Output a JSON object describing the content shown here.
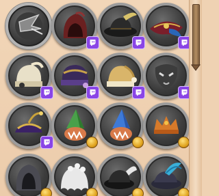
{
  "screen": "cosmetics-hat-grid",
  "colors": {
    "panel_background": "#efd2b3",
    "frame_silver": "#9c9c9c",
    "twitch_badge": "#8a45e6",
    "coin_gold": "#e0a31f",
    "scroll_thumb": "#a07a52"
  },
  "items": [
    {
      "icon": "ninja-mask-hat-icon",
      "badge": "none",
      "selected": true
    },
    {
      "icon": "crimson-hood-hat-icon",
      "badge": "twitch"
    },
    {
      "icon": "feathered-tricorn-hat-icon",
      "badge": "twitch"
    },
    {
      "icon": "pirate-captain-hat-icon",
      "badge": "twitch"
    },
    {
      "icon": "cream-beanie-hat-icon",
      "badge": "twitch"
    },
    {
      "icon": "purple-gold-beanie-hat-icon",
      "badge": "twitch"
    },
    {
      "icon": "gold-nightcap-hat-icon",
      "badge": "twitch"
    },
    {
      "icon": "dark-mask-hat-icon",
      "badge": "twitch"
    },
    {
      "icon": "jester-cap-hat-icon",
      "badge": "twitch"
    },
    {
      "icon": "green-gnome-hat-icon",
      "badge": "coin"
    },
    {
      "icon": "blue-gnome-hat-icon",
      "badge": "coin"
    },
    {
      "icon": "orange-crown-hat-icon",
      "badge": "coin"
    },
    {
      "icon": "dark-hood-hat-icon",
      "badge": "coin"
    },
    {
      "icon": "ghost-veil-hat-icon",
      "badge": "coin"
    },
    {
      "icon": "black-feathered-hat-icon",
      "badge": "coin"
    },
    {
      "icon": "blue-plumed-hat-icon",
      "badge": "coin"
    }
  ],
  "scrollbar": {
    "position_fraction": 0.0,
    "visible_fraction": 0.32
  }
}
